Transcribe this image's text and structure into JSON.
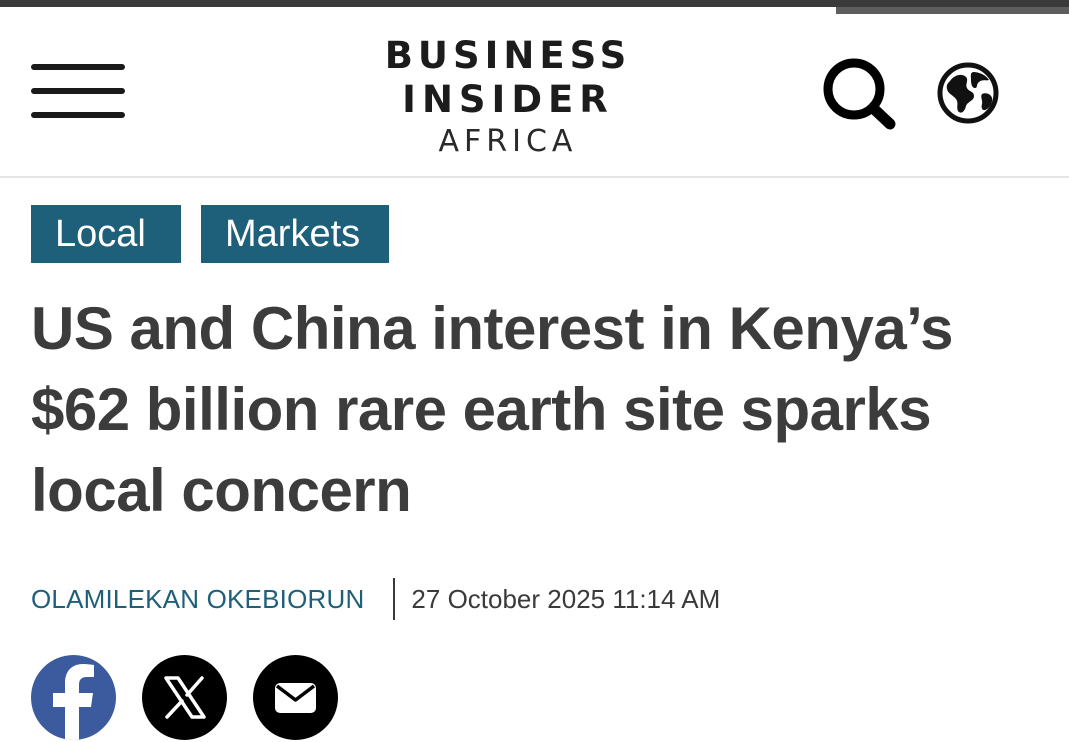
{
  "header": {
    "menu_icon": "hamburger-menu-icon",
    "logo": {
      "line1": "BUSINESS",
      "line2": "INSIDER",
      "line3": "AFRICA"
    },
    "search_icon": "search-icon",
    "globe_icon": "globe-icon"
  },
  "article": {
    "tags": [
      "Local",
      "Markets"
    ],
    "headline": "US and China interest in Kenya’s $62 billion rare earth site sparks local concern",
    "author": "OLAMILEKAN OKEBIORUN",
    "date": "27 October 2025 11:14 AM"
  },
  "share": {
    "facebook_icon": "facebook-icon",
    "x_icon": "x-logo-icon",
    "email_icon": "email-icon"
  },
  "colors": {
    "accent": "#1e5f7a",
    "facebook": "#3b5b9e",
    "headline_text": "#3c3c3c",
    "top_strip": "#3b3b3b"
  }
}
